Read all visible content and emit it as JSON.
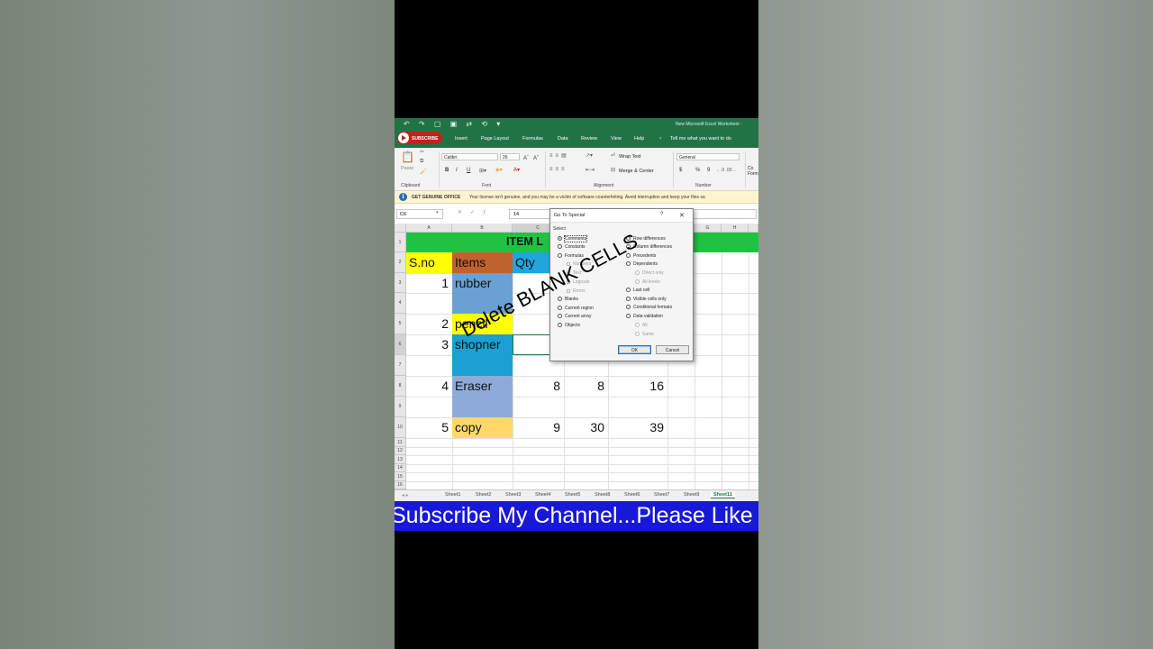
{
  "titlebar": {
    "qat_glyphs": "↶ ↷ ▢ ▣ ⇄ ⟲ ▾",
    "doc_title": "New Microsoft Excel Worksheet -"
  },
  "subscribe_badge": "SUBSCRIBE",
  "ribbon_tabs": [
    "Insert",
    "Page Layout",
    "Formulas",
    "Data",
    "Review",
    "View",
    "Help",
    "Tell me what you want to do"
  ],
  "ribbon": {
    "paste": "Paste",
    "font_name": "Calibri",
    "font_size": "26",
    "bold": "B",
    "italic": "I",
    "underline": "U",
    "wrap_text": "Wrap Text",
    "merge_center": "Merge & Center",
    "number_format": "General",
    "currency": "$",
    "percent": "%",
    "comma": "9",
    "groups": {
      "clipboard": "Clipboard",
      "font": "Font",
      "alignment": "Alignment",
      "number": "Number"
    },
    "cond_format": "Co Form"
  },
  "message_bar": {
    "title": "GET GENUINE OFFICE",
    "text": "Your license isn't genuine, and you may be a victim of software counterfeiting. Avoid interruption and keep your files sa"
  },
  "formula_bar": {
    "name_box": "C6",
    "value": "14"
  },
  "columns": [
    "A",
    "B",
    "C",
    "D",
    "E",
    "F",
    "G",
    "H"
  ],
  "rows": [
    "1",
    "2",
    "3",
    "4",
    "5",
    "6",
    "7",
    "8",
    "9",
    "10",
    "11",
    "12",
    "13",
    "14",
    "15",
    "16"
  ],
  "sheet": {
    "banner": "ITEM L",
    "headers": {
      "sno": "S.no",
      "items": "Items",
      "qty": "Qty"
    },
    "sno": [
      "1",
      "2",
      "3",
      "4",
      "5"
    ],
    "items": [
      "rubber",
      "pencil",
      "shopner",
      "Eraser",
      "copy"
    ],
    "row8": {
      "c": "8",
      "d": "8",
      "e": "16"
    },
    "row10": {
      "c": "9",
      "d": "30",
      "e": "39"
    }
  },
  "sheet_tabs": [
    "Sheet1",
    "Sheet2",
    "Sheet3",
    "Sheet4",
    "Sheet5",
    "Sheet8",
    "Sheet6",
    "Sheet7",
    "Sheet9",
    "Sheet11"
  ],
  "active_sheet_tab": "Sheet11",
  "dialog": {
    "title": "Go To Special",
    "help": "?",
    "close": "✕",
    "section": "Select",
    "left_options": [
      {
        "label": "Comments",
        "selected": true
      },
      {
        "label": "Constants",
        "selected": false
      },
      {
        "label": "Formulas",
        "selected": false
      },
      {
        "label": "Blanks",
        "selected": false
      },
      {
        "label": "Current region",
        "selected": false
      },
      {
        "label": "Current array",
        "selected": false
      },
      {
        "label": "Objects",
        "selected": false
      }
    ],
    "formula_subs": [
      "Numbers",
      "Text",
      "Logicals",
      "Errors"
    ],
    "right_options": [
      {
        "label": "Row differences"
      },
      {
        "label": "Column differences"
      },
      {
        "label": "Precedents"
      },
      {
        "label": "Dependents"
      },
      {
        "label": "Last cell"
      },
      {
        "label": "Visible cells only"
      },
      {
        "label": "Conditional formats"
      },
      {
        "label": "Data validation"
      }
    ],
    "dependents_subs": [
      "Direct only",
      "All levels"
    ],
    "validation_subs": [
      "All",
      "Same"
    ],
    "ok": "OK",
    "cancel": "Cancel"
  },
  "overlay_caption": "Delete BLANK CELLS",
  "ticker": "Subscribe My Channel...Please Like"
}
